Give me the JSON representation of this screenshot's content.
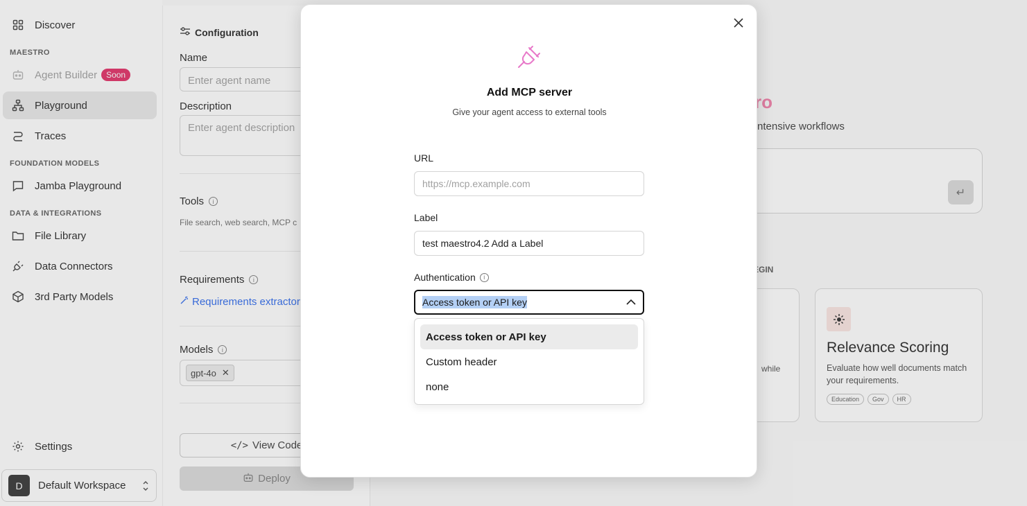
{
  "sidebar": {
    "discover": "Discover",
    "section_maestro": "MAESTRO",
    "agent_builder": "Agent Builder",
    "soon_badge": "Soon",
    "playground": "Playground",
    "traces": "Traces",
    "section_foundation": "FOUNDATION MODELS",
    "jamba_playground": "Jamba Playground",
    "section_data": "DATA & INTEGRATIONS",
    "file_library": "File Library",
    "data_connectors": "Data Connectors",
    "third_party_models": "3rd Party Models",
    "settings": "Settings",
    "workspace_initial": "D",
    "workspace_name": "Default Workspace"
  },
  "config": {
    "title": "Configuration",
    "name_label": "Name",
    "name_placeholder": "Enter agent name",
    "description_label": "Description",
    "description_placeholder": "Enter agent description",
    "tools_label": "Tools",
    "tools_help": "File search, web search, MCP c",
    "requirements_label": "Requirements",
    "requirements_link": "Requirements extractor",
    "models_label": "Models",
    "model_chip": "gpt-4o",
    "view_code": "View Code",
    "deploy": "Deploy"
  },
  "main": {
    "hero_title_fragment": "ro",
    "hero_sub_fragment": "ntensive workflows",
    "begin_fragment": "EGIN",
    "card_left_fragment": "while",
    "card": {
      "title": "Relevance Scoring",
      "description": "Evaluate how well documents match your requirements.",
      "tags": [
        "Education",
        "Gov",
        "HR"
      ]
    }
  },
  "modal": {
    "title": "Add MCP server",
    "subtitle": "Give your agent access to external tools",
    "url_label": "URL",
    "url_placeholder": "https://mcp.example.com",
    "label_label": "Label",
    "label_value": "test maestro4.2 Add a Label",
    "auth_label": "Authentication",
    "auth_selected": "Access token or API key",
    "auth_options": [
      "Access token or API key",
      "Custom header",
      "none"
    ]
  },
  "colors": {
    "accent_pink": "#f178a4",
    "badge_red": "#e0245e",
    "link_blue": "#2563eb",
    "selection_blue": "#b4d0f5"
  }
}
